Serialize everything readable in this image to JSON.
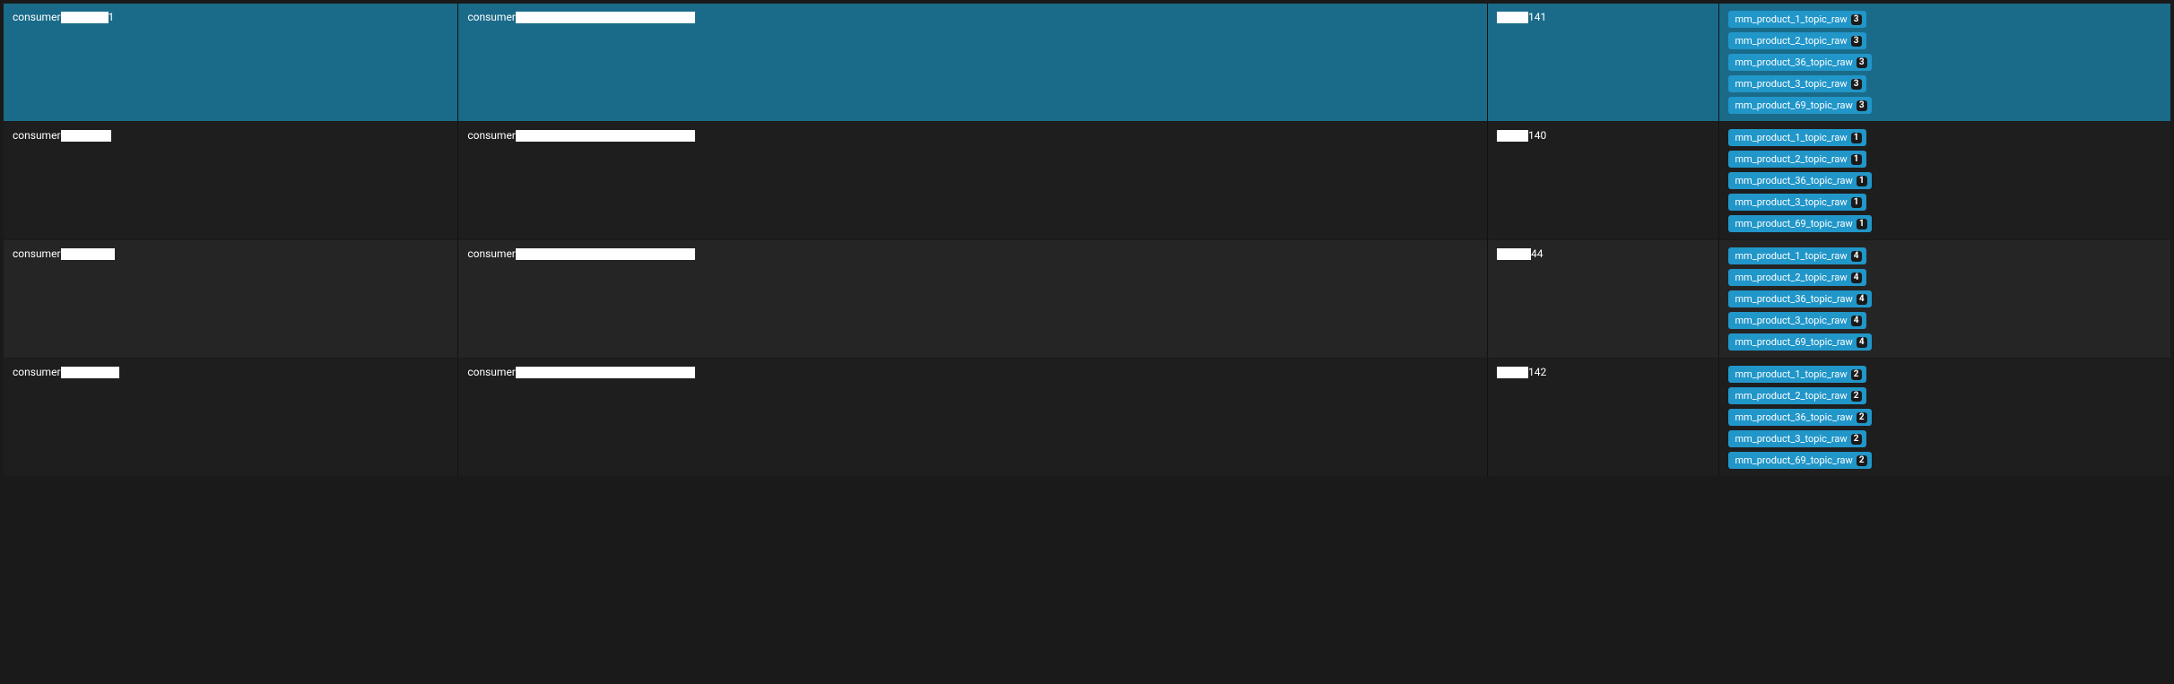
{
  "rows": [
    {
      "selected": true,
      "col1_prefix": "consumer",
      "col1_redacted_width": 53,
      "col1_suffix": "1",
      "col2_prefix": "consumer",
      "col2_redacted_width": 200,
      "col2_suffix": "",
      "col3_prefix": "",
      "col3_redacted_width": 35,
      "col3_suffix": "141",
      "topics": [
        {
          "name": "mm_product_1_topic_raw",
          "count": "3"
        },
        {
          "name": "mm_product_2_topic_raw",
          "count": "3"
        },
        {
          "name": "mm_product_36_topic_raw",
          "count": "3"
        },
        {
          "name": "mm_product_3_topic_raw",
          "count": "3"
        },
        {
          "name": "mm_product_69_topic_raw",
          "count": "3"
        }
      ]
    },
    {
      "selected": false,
      "bg": "dark",
      "col1_prefix": "consumer",
      "col1_redacted_width": 56,
      "col1_suffix": "",
      "col2_prefix": "consumer",
      "col2_redacted_width": 200,
      "col2_suffix": "",
      "col3_prefix": "",
      "col3_redacted_width": 35,
      "col3_suffix": "140",
      "topics": [
        {
          "name": "mm_product_1_topic_raw",
          "count": "1"
        },
        {
          "name": "mm_product_2_topic_raw",
          "count": "1"
        },
        {
          "name": "mm_product_36_topic_raw",
          "count": "1"
        },
        {
          "name": "mm_product_3_topic_raw",
          "count": "1"
        },
        {
          "name": "mm_product_69_topic_raw",
          "count": "1"
        }
      ]
    },
    {
      "selected": false,
      "bg": "darker",
      "col1_prefix": "consumer",
      "col1_redacted_width": 60,
      "col1_suffix": "",
      "col2_prefix": "consumer",
      "col2_redacted_width": 200,
      "col2_suffix": "",
      "col3_prefix": "",
      "col3_redacted_width": 38,
      "col3_suffix": "44",
      "topics": [
        {
          "name": "mm_product_1_topic_raw",
          "count": "4"
        },
        {
          "name": "mm_product_2_topic_raw",
          "count": "4"
        },
        {
          "name": "mm_product_36_topic_raw",
          "count": "4"
        },
        {
          "name": "mm_product_3_topic_raw",
          "count": "4"
        },
        {
          "name": "mm_product_69_topic_raw",
          "count": "4"
        }
      ]
    },
    {
      "selected": false,
      "bg": "dark",
      "col1_prefix": "consumer",
      "col1_redacted_width": 65,
      "col1_suffix": "",
      "col2_prefix": "consumer",
      "col2_redacted_width": 200,
      "col2_suffix": "",
      "col3_prefix": "",
      "col3_redacted_width": 35,
      "col3_suffix": "142",
      "topics": [
        {
          "name": "mm_product_1_topic_raw",
          "count": "2"
        },
        {
          "name": "mm_product_2_topic_raw",
          "count": "2"
        },
        {
          "name": "mm_product_36_topic_raw",
          "count": "2"
        },
        {
          "name": "mm_product_3_topic_raw",
          "count": "2"
        },
        {
          "name": "mm_product_69_topic_raw",
          "count": "2"
        }
      ]
    }
  ]
}
